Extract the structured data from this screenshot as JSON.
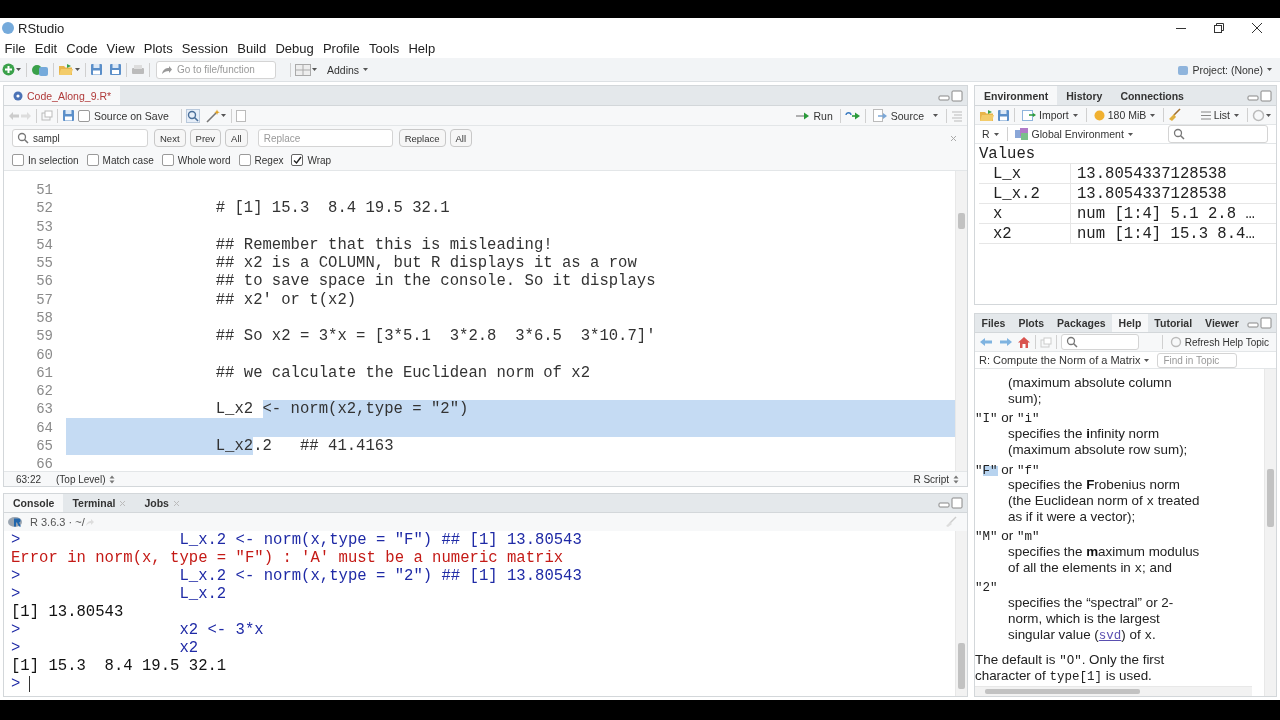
{
  "window": {
    "title": "RStudio"
  },
  "menu": [
    "File",
    "Edit",
    "Code",
    "View",
    "Plots",
    "Session",
    "Build",
    "Debug",
    "Profile",
    "Tools",
    "Help"
  ],
  "toolbar": {
    "goto_placeholder": "Go to file/function",
    "addins": "Addins",
    "project": "Project: (None)"
  },
  "editor": {
    "tabs": [
      {
        "label": "Code_Along_9.R*",
        "selected": true
      }
    ],
    "source_on_save": {
      "label": "Source on Save",
      "checked": false
    },
    "run": "Run",
    "source": "Source",
    "find": {
      "value": "sampl",
      "next": "Next",
      "prev": "Prev",
      "all": "All",
      "replace_placeholder": "Replace",
      "replace": "Replace",
      "replace_all": "All"
    },
    "options": [
      {
        "label": "In selection",
        "checked": false
      },
      {
        "label": "Match case",
        "checked": false
      },
      {
        "label": "Whole word",
        "checked": false
      },
      {
        "label": "Regex",
        "checked": false
      },
      {
        "label": "Wrap",
        "checked": true
      }
    ],
    "lines": [
      {
        "number": "51",
        "selected_to_end": false
      },
      {
        "number": "52",
        "text": "                # [1] 15.3  8.4 19.5 32.1",
        "selected_to_end": false
      },
      {
        "number": "53",
        "selected_to_end": false
      },
      {
        "number": "54",
        "text": "                ## Remember that this is misleading!",
        "selected_to_end": false
      },
      {
        "number": "55",
        "text": "                ## x2 is a COLUMN, but R displays it as a row",
        "selected_to_end": false
      },
      {
        "number": "56",
        "text": "                ## to save space in the console. So it displays",
        "selected_to_end": false
      },
      {
        "number": "57",
        "text": "                ## x2' or t(x2)",
        "selected_to_end": false
      },
      {
        "number": "58",
        "selected_to_end": false
      },
      {
        "number": "59",
        "text": "                ## So x2 = 3*x = [3*5.1  3*2.8  3*6.5  3*10.7]'",
        "selected_to_end": false
      },
      {
        "number": "60",
        "selected_to_end": false
      },
      {
        "number": "61",
        "text": "                ## we calculate the Euclidean norm of x2",
        "selected_to_end": false
      },
      {
        "number": "62",
        "selected_to_end": false
      },
      {
        "number": "63",
        "segments": [
          {
            "text": "                L_x2 ",
            "selected": false
          },
          {
            "text": "<- norm(x2,type = \"2\")",
            "selected": true
          }
        ],
        "selected_to_end": true
      },
      {
        "number": "64",
        "selected_to_end": true
      },
      {
        "number": "65",
        "segments": [
          {
            "text": "                L_x2",
            "selected": true
          },
          {
            "text": ".2   ## 41.4163",
            "selected": false
          }
        ],
        "selected_to_end": false
      },
      {
        "number": "66",
        "selected_to_end": false
      }
    ],
    "cursor": "63:22",
    "scope": "(Top Level)",
    "file_type": "R Script"
  },
  "console": {
    "tabs": [
      {
        "label": "Console",
        "selected": true,
        "closable": false
      },
      {
        "label": "Terminal",
        "selected": false,
        "closable": true
      },
      {
        "label": "Jobs",
        "selected": false,
        "closable": true
      }
    ],
    "version": "R 3.6.3 · ~/",
    "lines": [
      {
        "kind": "command",
        "prompt": ">",
        "text": "                 L_x.2 <- norm(x,type = \"F\") ## [1] 13.80543"
      },
      {
        "kind": "error",
        "text": "Error in norm(x, type = \"F\") : 'A' must be a numeric matrix"
      },
      {
        "kind": "command",
        "prompt": ">",
        "text": "                 L_x.2 <- norm(x,type = \"2\") ## [1] 13.80543"
      },
      {
        "kind": "command",
        "prompt": ">",
        "text": "                 L_x.2"
      },
      {
        "kind": "output",
        "text": "[1] 13.80543"
      },
      {
        "kind": "command",
        "prompt": ">",
        "text": "                 x2 <- 3*x"
      },
      {
        "kind": "command",
        "prompt": ">",
        "text": "                 x2"
      },
      {
        "kind": "output",
        "text": "[1] 15.3  8.4 19.5 32.1"
      },
      {
        "kind": "input",
        "prompt": ">"
      }
    ]
  },
  "environment": {
    "tabs": [
      {
        "label": "Environment",
        "selected": true
      },
      {
        "label": "History",
        "selected": false
      },
      {
        "label": "Connections",
        "selected": false
      }
    ],
    "import": "Import",
    "memory": "180 MiB",
    "view": "List",
    "language": "R",
    "scope": "Global Environment",
    "section": "Values",
    "rows": [
      {
        "name": "L_x",
        "value": "13.8054337128538"
      },
      {
        "name": "L_x.2",
        "value": "13.8054337128538"
      },
      {
        "name": "x",
        "value": "num [1:4] 5.1 2.8 …"
      },
      {
        "name": "x2",
        "value": "num [1:4] 15.3 8.4…"
      }
    ]
  },
  "help": {
    "tabs": [
      {
        "label": "Files",
        "selected": false
      },
      {
        "label": "Plots",
        "selected": false
      },
      {
        "label": "Packages",
        "selected": false
      },
      {
        "label": "Help",
        "selected": true
      },
      {
        "label": "Tutorial",
        "selected": false
      },
      {
        "label": "Viewer",
        "selected": false
      }
    ],
    "refresh": "Refresh Help Topic",
    "topic": "R: Compute the Norm of a Matrix",
    "find_placeholder": "Find in Topic",
    "blocks": [
      {
        "description": [
          {
            "kind": "text",
            "text": "(maximum absolute column sum);"
          }
        ]
      },
      {
        "term": [
          {
            "kind": "code",
            "text": "\"I\""
          },
          {
            "kind": "text",
            "text": " or "
          },
          {
            "kind": "code",
            "text": "\"i\""
          }
        ],
        "description": [
          {
            "kind": "text",
            "text": "specifies the "
          },
          {
            "kind": "bold",
            "text": "i"
          },
          {
            "kind": "text",
            "text": "nfinity norm (maximum absolute row sum);"
          }
        ]
      },
      {
        "term": [
          {
            "kind": "code",
            "text": "\""
          },
          {
            "kind": "match",
            "text": "F\""
          },
          {
            "kind": "text",
            "text": " or "
          },
          {
            "kind": "code",
            "text": "\"f\""
          }
        ],
        "description": [
          {
            "kind": "text",
            "text": "specifies the "
          },
          {
            "kind": "bold",
            "text": "F"
          },
          {
            "kind": "text",
            "text": "robenius norm (the Euclidean norm of "
          },
          {
            "kind": "code",
            "text": "x"
          },
          {
            "kind": "text",
            "text": " treated as if it were a vector);"
          }
        ]
      },
      {
        "term": [
          {
            "kind": "code",
            "text": "\"M\""
          },
          {
            "kind": "text",
            "text": " or "
          },
          {
            "kind": "code",
            "text": "\"m\""
          }
        ],
        "description": [
          {
            "kind": "text",
            "text": "specifies the "
          },
          {
            "kind": "bold",
            "text": "m"
          },
          {
            "kind": "text",
            "text": "aximum modulus of all the elements in "
          },
          {
            "kind": "code",
            "text": "x"
          },
          {
            "kind": "text",
            "text": "; and"
          }
        ]
      },
      {
        "term": [
          {
            "kind": "code",
            "text": "\"2\""
          }
        ],
        "description": [
          {
            "kind": "text",
            "text": "specifies the “spectral” or 2-norm, which is the largest singular value ("
          },
          {
            "kind": "link",
            "text": "svd"
          },
          {
            "kind": "text",
            "text": ") of "
          },
          {
            "kind": "code",
            "text": "x"
          },
          {
            "kind": "text",
            "text": "."
          }
        ]
      }
    ],
    "footer": [
      {
        "kind": "text",
        "text": "The default is "
      },
      {
        "kind": "code",
        "text": "\"O\""
      },
      {
        "kind": "text",
        "text": ". Only the first character of "
      },
      {
        "kind": "code",
        "text": "type[1]"
      },
      {
        "kind": "text",
        "text": " is used."
      }
    ]
  }
}
